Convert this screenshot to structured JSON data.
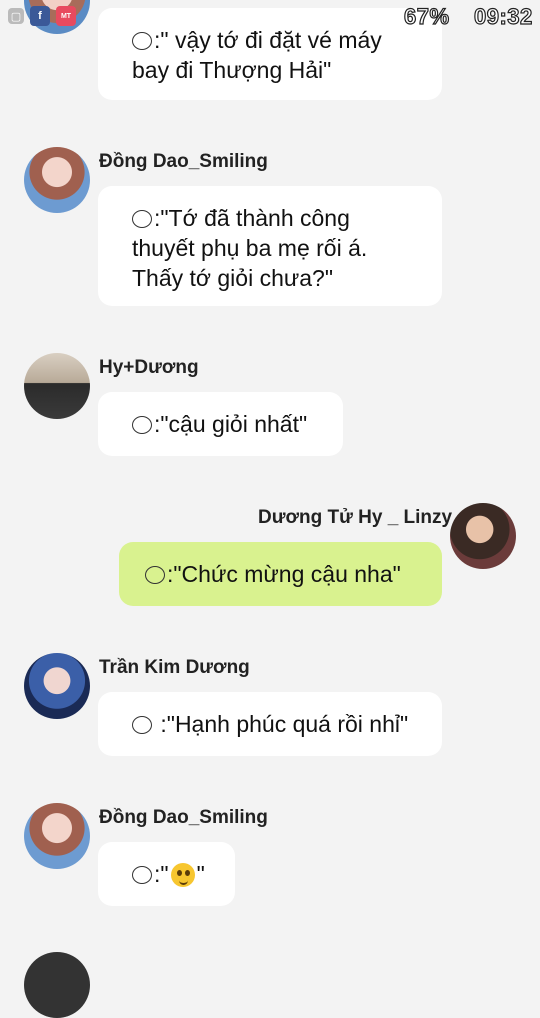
{
  "status_bar": {
    "battery": "67%",
    "time": "09:32",
    "app_icons": [
      "image-icon",
      "facebook-icon",
      "mangatoon-icon"
    ]
  },
  "messages": [
    {
      "name": "",
      "side": "left",
      "text": ":\" vậy tớ đi đặt vé máy\nbay đi Thượng Hải\"",
      "bubble_color": "#ffffff"
    },
    {
      "name": "Đồng Dao_Smiling",
      "side": "left",
      "text": ":\"Tớ đã thành công\nthuyết phụ ba mẹ rối á.\nThấy tớ giỏi chưa?\"",
      "bubble_color": "#ffffff"
    },
    {
      "name": "Hy+Dương",
      "side": "left",
      "text": ":\"cậu giỏi nhất\"",
      "bubble_color": "#ffffff"
    },
    {
      "name": "Dương Tử Hy _ Linzy",
      "side": "right",
      "text": ":\"Chức mừng cậu nha\"",
      "bubble_color": "#d9f28f"
    },
    {
      "name": "Trần Kim Dương",
      "side": "left",
      "text": " :\"Hạnh phúc quá rồi nhỉ\"",
      "bubble_color": "#ffffff"
    },
    {
      "name": "Đồng Dao_Smiling",
      "side": "left",
      "text_before": ":\"",
      "text_after": "\"",
      "emoji": "winking-face-emoji",
      "bubble_color": "#ffffff"
    }
  ]
}
